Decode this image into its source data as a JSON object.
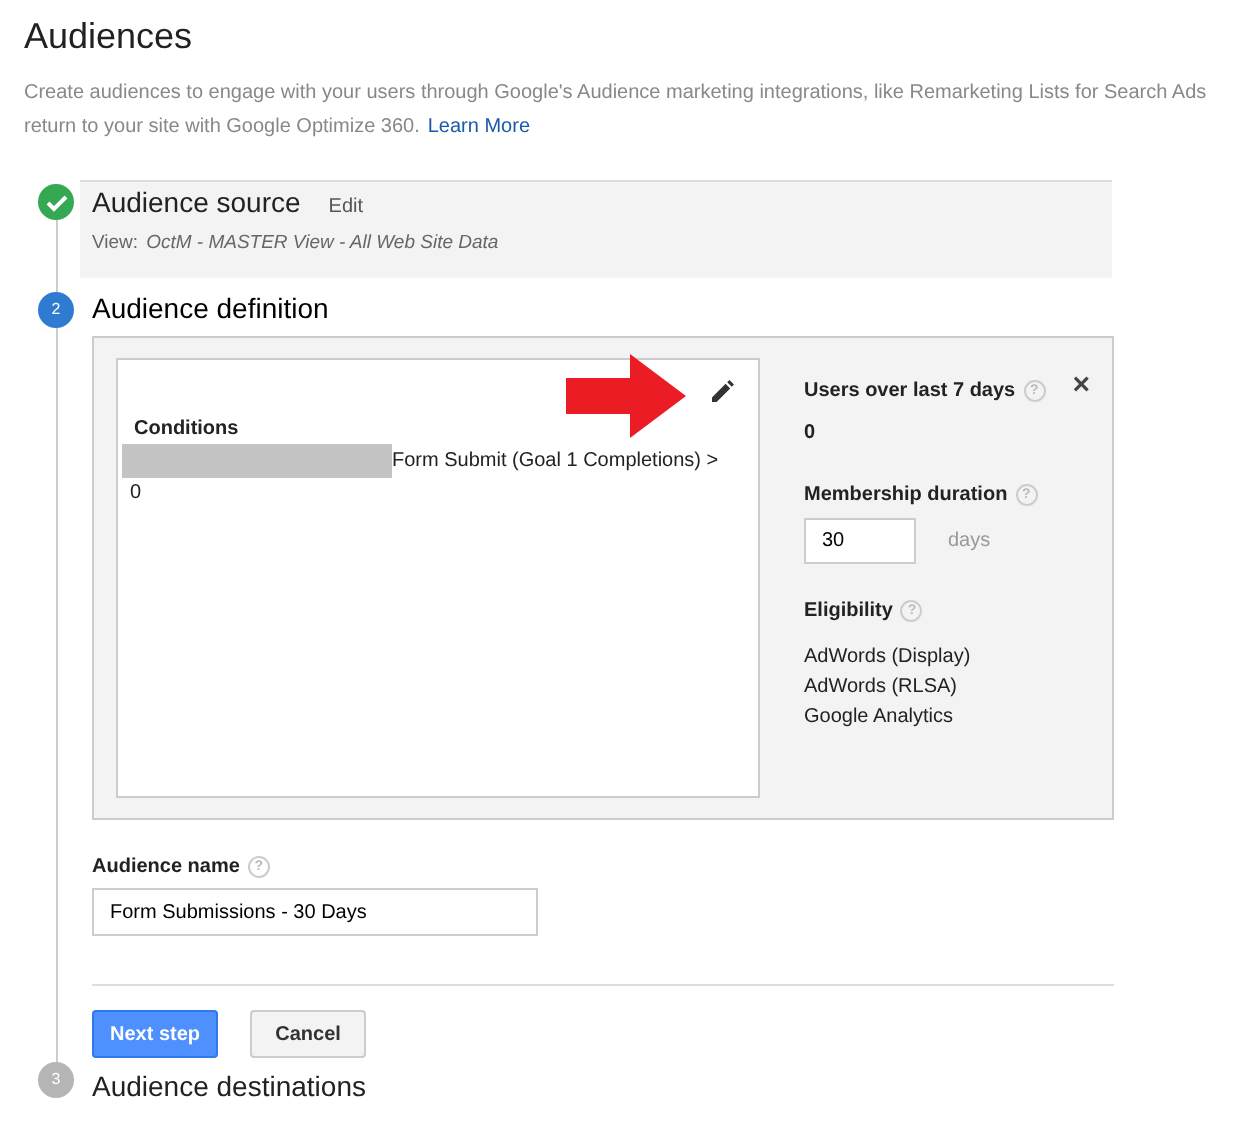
{
  "title": "Audiences",
  "description": {
    "line_1": "Create audiences to engage with your users through Google's Audience marketing integrations, like Remarketing Lists for Search Ads",
    "line_2": "return to your site with Google Optimize 360.",
    "link": "Learn More"
  },
  "steps": [
    {
      "completed": true,
      "selected": false,
      "title": "Audience source",
      "edit": "Edit",
      "view_label": "View:",
      "view_value": "OctM - MASTER View - All Web Site Data"
    },
    {
      "completed": false,
      "selected": true,
      "number": "2",
      "title": "Audience definition"
    },
    {
      "completed": false,
      "selected": false,
      "number": "3",
      "title": "Audience destinations"
    }
  ],
  "definition": {
    "conditions_title": "Conditions",
    "condition_text": "Form Submit (Goal 1 Completions) >",
    "condition_value": "0",
    "users_label": "Users over last 7 days",
    "users_value": "0",
    "close": "×",
    "duration_label": "Membership duration",
    "duration_value": "30",
    "duration_unit": "days",
    "eligibility_label": "Eligibility",
    "eligibility": [
      "AdWords (Display)",
      "AdWords (RLSA)",
      "Google Analytics"
    ],
    "help": "?"
  },
  "audience_name": {
    "label": "Audience name",
    "value": "Form Submissions - 30 Days"
  },
  "buttons": [
    {
      "label": "Next step",
      "kind": "primary"
    },
    {
      "label": "Cancel",
      "kind": "secondary"
    }
  ]
}
